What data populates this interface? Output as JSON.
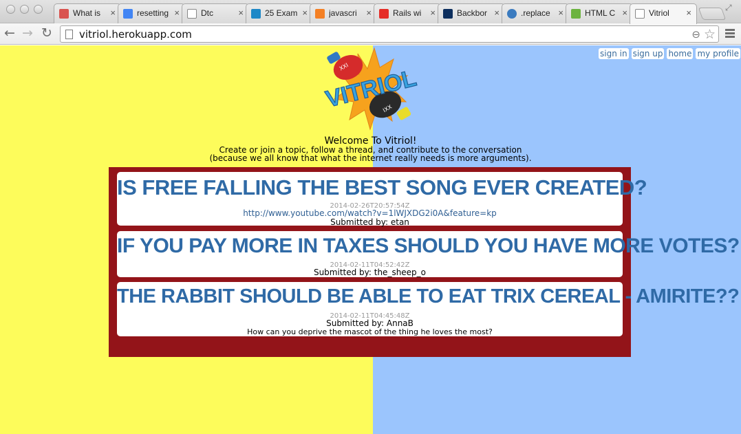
{
  "browser": {
    "tabs": [
      {
        "title": "What is",
        "favicon_color": "#d9534f"
      },
      {
        "title": "resetting",
        "favicon_color": "#4285f4"
      },
      {
        "title": "Dtc",
        "favicon_color": "#ffffff"
      },
      {
        "title": "25 Exam",
        "favicon_color": "#1e88c7"
      },
      {
        "title": "javascri",
        "favicon_color": "#f48024"
      },
      {
        "title": "Rails wi",
        "favicon_color": "#e52d27"
      },
      {
        "title": "Backbor",
        "favicon_color": "#0d2f5e"
      },
      {
        "title": ".replace",
        "favicon_color": "#3b7bbf"
      },
      {
        "title": "HTML C",
        "favicon_color": "#6cb33f"
      },
      {
        "title": "Vitriol",
        "favicon_color": "#ffffff"
      }
    ],
    "url": "vitriol.herokuapp.com"
  },
  "nav": {
    "sign_in": "sign in",
    "sign_up": "sign up",
    "home": "home",
    "my_profile": "my profile"
  },
  "logo_text": "VITRIOL",
  "welcome": {
    "title": "Welcome To Vitriol!",
    "line1": "Create or join a topic, follow a thread, and contribute to the conversation",
    "line2": "(because we all know that what the internet really needs is more arguments)."
  },
  "topics": [
    {
      "title": "IS FREE FALLING THE BEST SONG EVER CREATED?",
      "date": "2014-02-26T20:57:54Z",
      "link": "http://www.youtube.com/watch?v=1lWJXDG2i0A&feature=kp",
      "submitted_by": "Submitted by: etan"
    },
    {
      "title": "IF YOU PAY MORE IN TAXES SHOULD YOU HAVE MORE VOTES?",
      "date": "2014-02-11T04:52:42Z",
      "submitted_by": "Submitted by: the_sheep_o"
    },
    {
      "title": "THE RABBIT SHOULD BE ABLE TO EAT TRIX CEREAL - AMIRITE??",
      "date": "2014-02-11T04:45:48Z",
      "submitted_by": "Submitted by: AnnaB",
      "description": "How can you deprive the mascot of the thing he loves the most?"
    }
  ],
  "colors": {
    "left_bg": "#fdfc5b",
    "right_bg": "#9bc5fd",
    "board": "#931419",
    "title_blue": "#2f6aa6"
  }
}
